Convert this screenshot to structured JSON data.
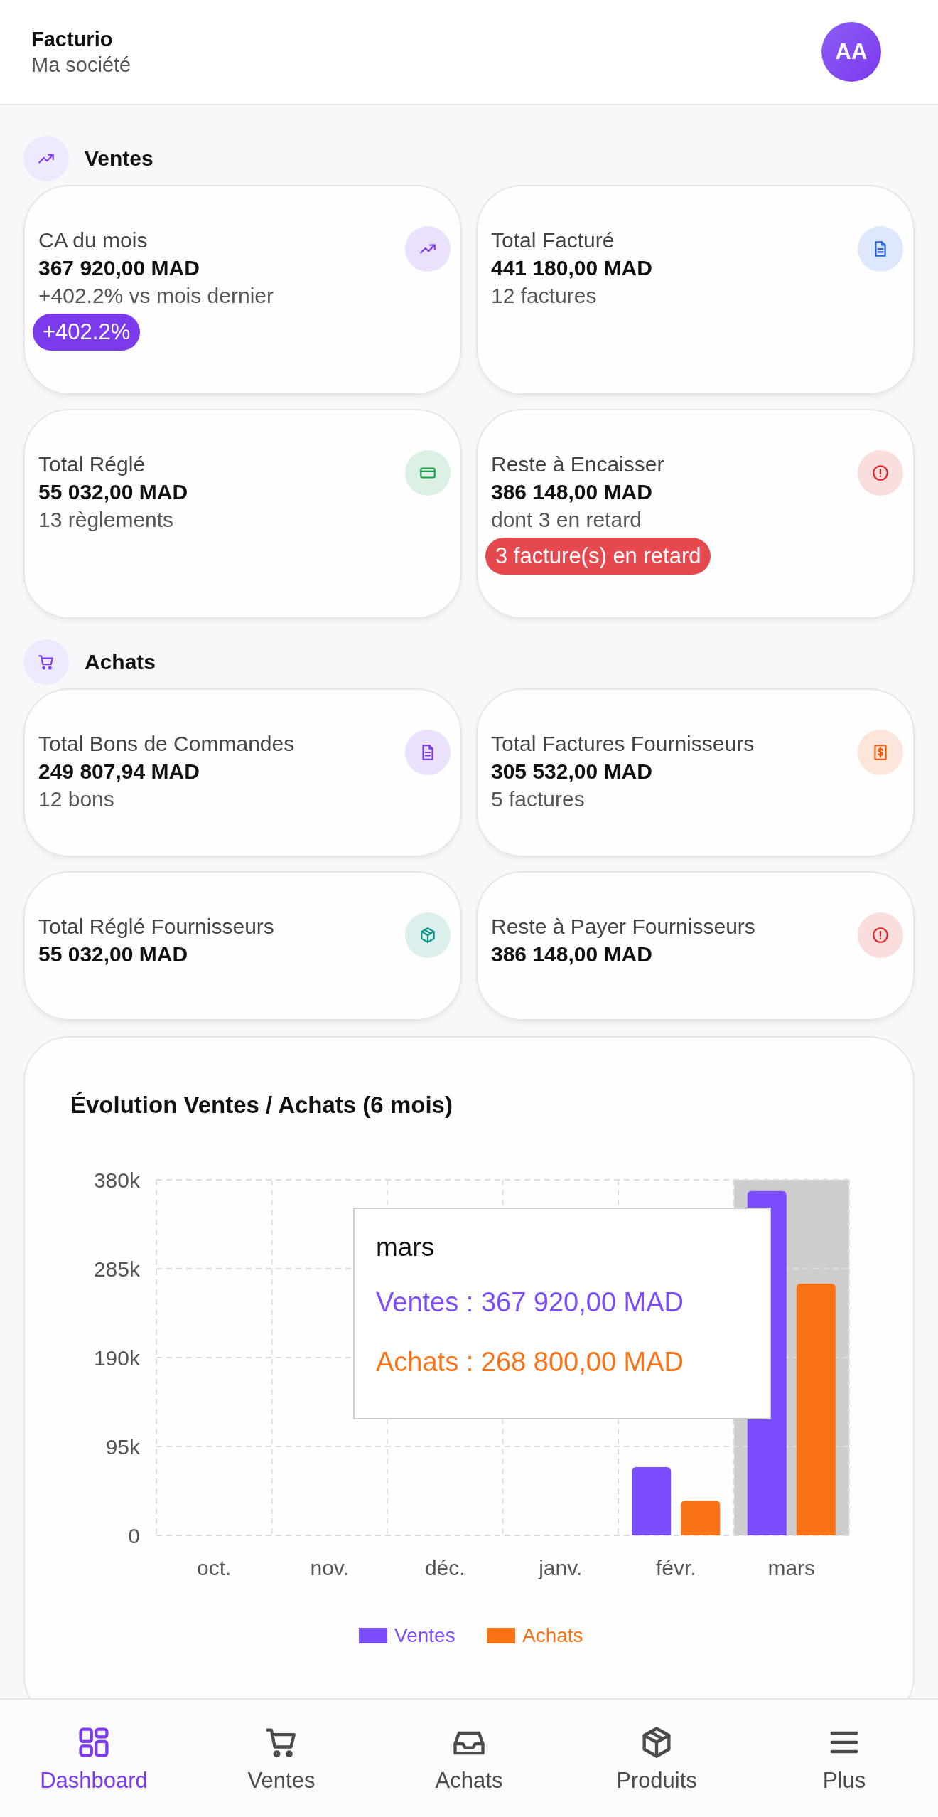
{
  "header": {
    "app_name": "Facturio",
    "company": "Ma société",
    "avatar": "AA"
  },
  "sections": [
    {
      "title": "Ventes",
      "cards": [
        {
          "label": "CA du mois",
          "value": "367 920,00 MAD",
          "detail": "+402.2% vs mois dernier",
          "color": "#7c3aed",
          "badge": {
            "text": "+402.2%",
            "kind": "accent"
          }
        },
        {
          "label": "Total Facturé",
          "value": "441 180,00 MAD",
          "detail": "12 factures",
          "color": "#2563eb"
        },
        {
          "label": "Total Réglé",
          "value": "55 032,00 MAD",
          "detail": "13 règlements",
          "color": "#16a34a"
        },
        {
          "label": "Reste à Encaisser",
          "value": "386 148,00 MAD",
          "detail": "dont 3 en retard",
          "color": "#dc2626",
          "badge": {
            "text": "3 facture(s) en retard",
            "kind": "danger"
          }
        }
      ]
    },
    {
      "title": "Achats",
      "cards": [
        {
          "label": "Total Bons de Commandes",
          "value": "249 807,94 MAD",
          "detail": "12 bons",
          "color": "#7c3aed"
        },
        {
          "label": "Total Factures Fournisseurs",
          "value": "305 532,00 MAD",
          "detail": "5 factures",
          "color": "#ea580c"
        },
        {
          "label": "Total Réglé Fournisseurs",
          "value": "55 032,00 MAD",
          "color": "#0d9488"
        },
        {
          "label": "Reste à Payer Fournisseurs",
          "value": "386 148,00 MAD",
          "color": "#dc2626"
        }
      ]
    }
  ],
  "chart": {
    "title": "Évolution Ventes / Achats (6 mois)",
    "chart_data": {
      "type": "bar",
      "categories": [
        "oct.",
        "nov.",
        "déc.",
        "janv.",
        "févr.",
        "mars"
      ],
      "series": [
        {
          "name": "Ventes",
          "color": "#7c4dff",
          "values": [
            0,
            0,
            0,
            0,
            73000,
            368000
          ]
        },
        {
          "name": "Achats",
          "color": "#f97316",
          "values": [
            0,
            0,
            0,
            0,
            37000,
            269000
          ]
        }
      ],
      "ylim": [
        0,
        380000
      ],
      "yticks": [
        {
          "value": 0,
          "label": "0"
        },
        {
          "value": 95000,
          "label": "95k"
        },
        {
          "value": 190000,
          "label": "190k"
        },
        {
          "value": 285000,
          "label": "285k"
        },
        {
          "value": 380000,
          "label": "380k"
        }
      ],
      "grid": true,
      "legend": "bottom"
    },
    "tooltip": {
      "title": "mars",
      "lines": [
        "Ventes : 367 920,00 MAD",
        "Achats : 268 800,00 MAD"
      ]
    }
  },
  "nav": [
    {
      "label": "Dashboard",
      "selected": true
    },
    {
      "label": "Ventes",
      "selected": false
    },
    {
      "label": "Achats",
      "selected": false
    },
    {
      "label": "Produits",
      "selected": false
    },
    {
      "label": "Plus",
      "selected": false
    }
  ]
}
